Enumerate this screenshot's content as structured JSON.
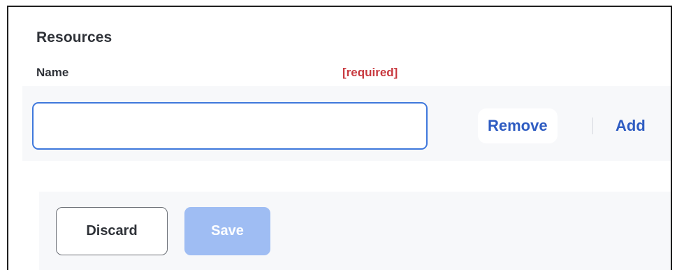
{
  "section": {
    "title": "Resources"
  },
  "field": {
    "label": "Name",
    "required_text": "[required]",
    "value": "",
    "placeholder": ""
  },
  "row_actions": {
    "remove_label": "Remove",
    "add_label": "Add"
  },
  "footer": {
    "discard_label": "Discard",
    "save_label": "Save",
    "save_disabled": true
  },
  "colors": {
    "accent": "#2e5cc2",
    "input_focus_border": "#3f78dc",
    "required": "#c8393f",
    "save_disabled_bg": "#9fbdf3",
    "band_bg": "#f7f8fa"
  }
}
